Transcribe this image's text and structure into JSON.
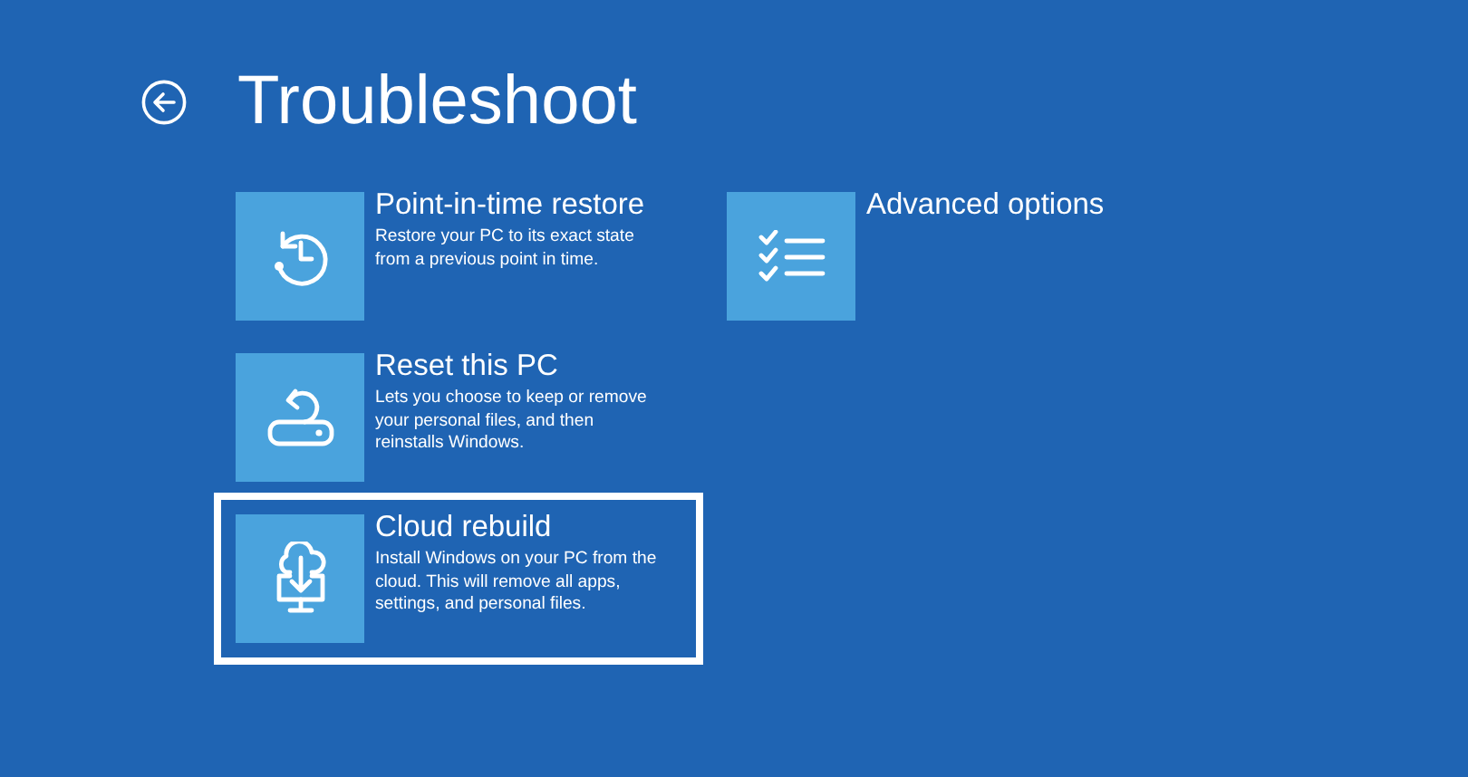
{
  "title": "Troubleshoot",
  "columns": [
    [
      {
        "kind": "restore",
        "title": "Point-in-time restore",
        "description": "Restore your PC to its exact state from a previous point in time.",
        "selected": false
      },
      {
        "kind": "reset",
        "title": "Reset this PC",
        "description": "Lets you choose to keep or remove your personal files, and then reinstalls Windows.",
        "selected": false
      },
      {
        "kind": "cloud",
        "title": "Cloud rebuild",
        "description": "Install Windows on your PC from the cloud. This will remove all apps, settings, and personal files.",
        "selected": true
      }
    ],
    [
      {
        "kind": "advanced",
        "title": "Advanced options",
        "selected": false
      }
    ]
  ]
}
